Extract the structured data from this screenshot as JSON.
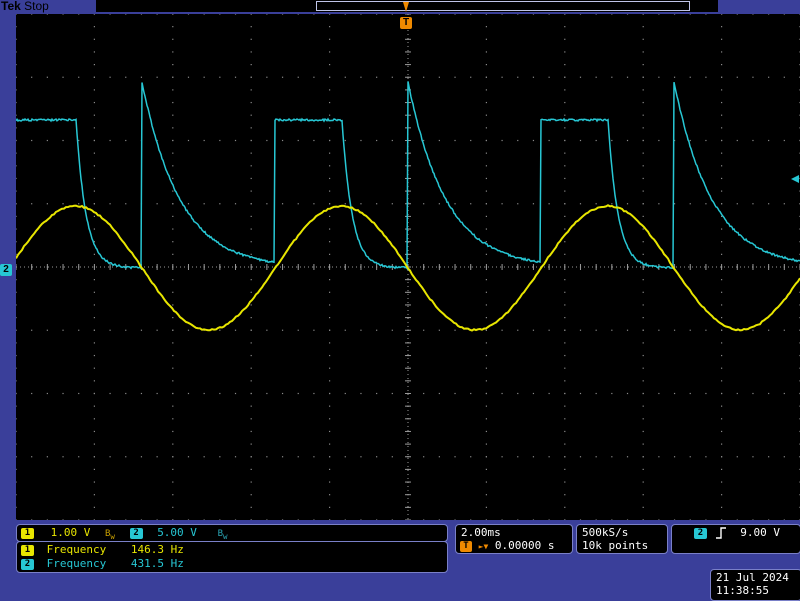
{
  "header": {
    "brand": "Tek",
    "status": "Stop"
  },
  "markers": {
    "ch2_ground": "2",
    "trigger": "T"
  },
  "channels": {
    "ch1": {
      "number": "1",
      "scale": "1.00 V",
      "color": "#e8e600",
      "bandwidth_icon": "BW-limit-icon"
    },
    "ch2": {
      "number": "2",
      "scale": "5.00 V",
      "color": "#27c7d4",
      "bandwidth_icon": "BW-limit-icon"
    }
  },
  "measurements": [
    {
      "channel": "1",
      "label": "Frequency",
      "value": "146.3 Hz"
    },
    {
      "channel": "2",
      "label": "Frequency",
      "value": "431.5 Hz"
    }
  ],
  "timebase": {
    "scale": "2.00ms",
    "trigger_badge": "T",
    "position": "0.00000 s"
  },
  "acquisition": {
    "sample_rate": "500kS/s",
    "record_length": "10k points"
  },
  "trigger": {
    "source": "2",
    "slope_icon": "rising-edge-icon",
    "level": "9.00 V"
  },
  "datetime": {
    "date": "21 Jul  2024",
    "time": "11:38:55"
  },
  "colors": {
    "ch1": "#e8e600",
    "ch2": "#27c7d4",
    "trigger": "#f08a00",
    "background": "#3a3f9a"
  }
}
